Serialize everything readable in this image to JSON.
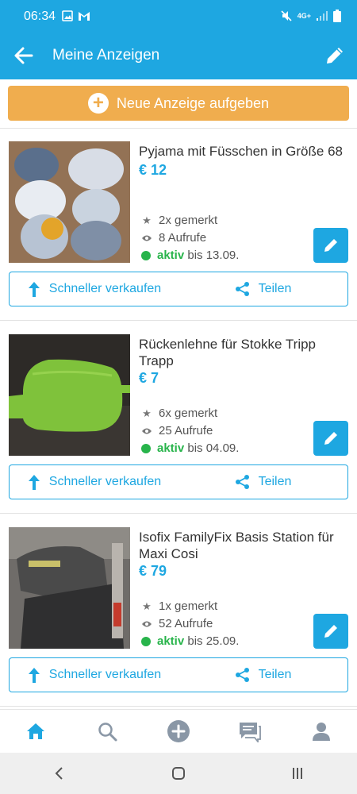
{
  "status": {
    "time": "06:34",
    "network": "4G+"
  },
  "appbar": {
    "title": "Meine Anzeigen"
  },
  "new_ad_button": {
    "label": "Neue Anzeige aufgeben"
  },
  "listings": [
    {
      "title": "Pyjama mit Füsschen in Größe 68",
      "price": "€ 12",
      "saved": "2x gemerkt",
      "views": "8 Aufrufe",
      "status": "aktiv",
      "until": "bis 13.09."
    },
    {
      "title": "Rückenlehne für Stokke Tripp Trapp",
      "price": "€ 7",
      "saved": "6x gemerkt",
      "views": "25 Aufrufe",
      "status": "aktiv",
      "until": "bis 04.09."
    },
    {
      "title": "Isofix FamilyFix Basis Station für Maxi Cosi",
      "price": "€ 79",
      "saved": "1x gemerkt",
      "views": "52 Aufrufe",
      "status": "aktiv",
      "until": "bis 25.09."
    }
  ],
  "actions": {
    "sell_faster": "Schneller verkaufen",
    "share": "Teilen"
  },
  "bottom_nav": [
    "home-icon",
    "search-icon",
    "add-icon",
    "messages-icon",
    "profile-icon"
  ],
  "colors": {
    "primary": "#1ea7e1",
    "accent": "#f0ad4e",
    "active": "#28b44b"
  }
}
